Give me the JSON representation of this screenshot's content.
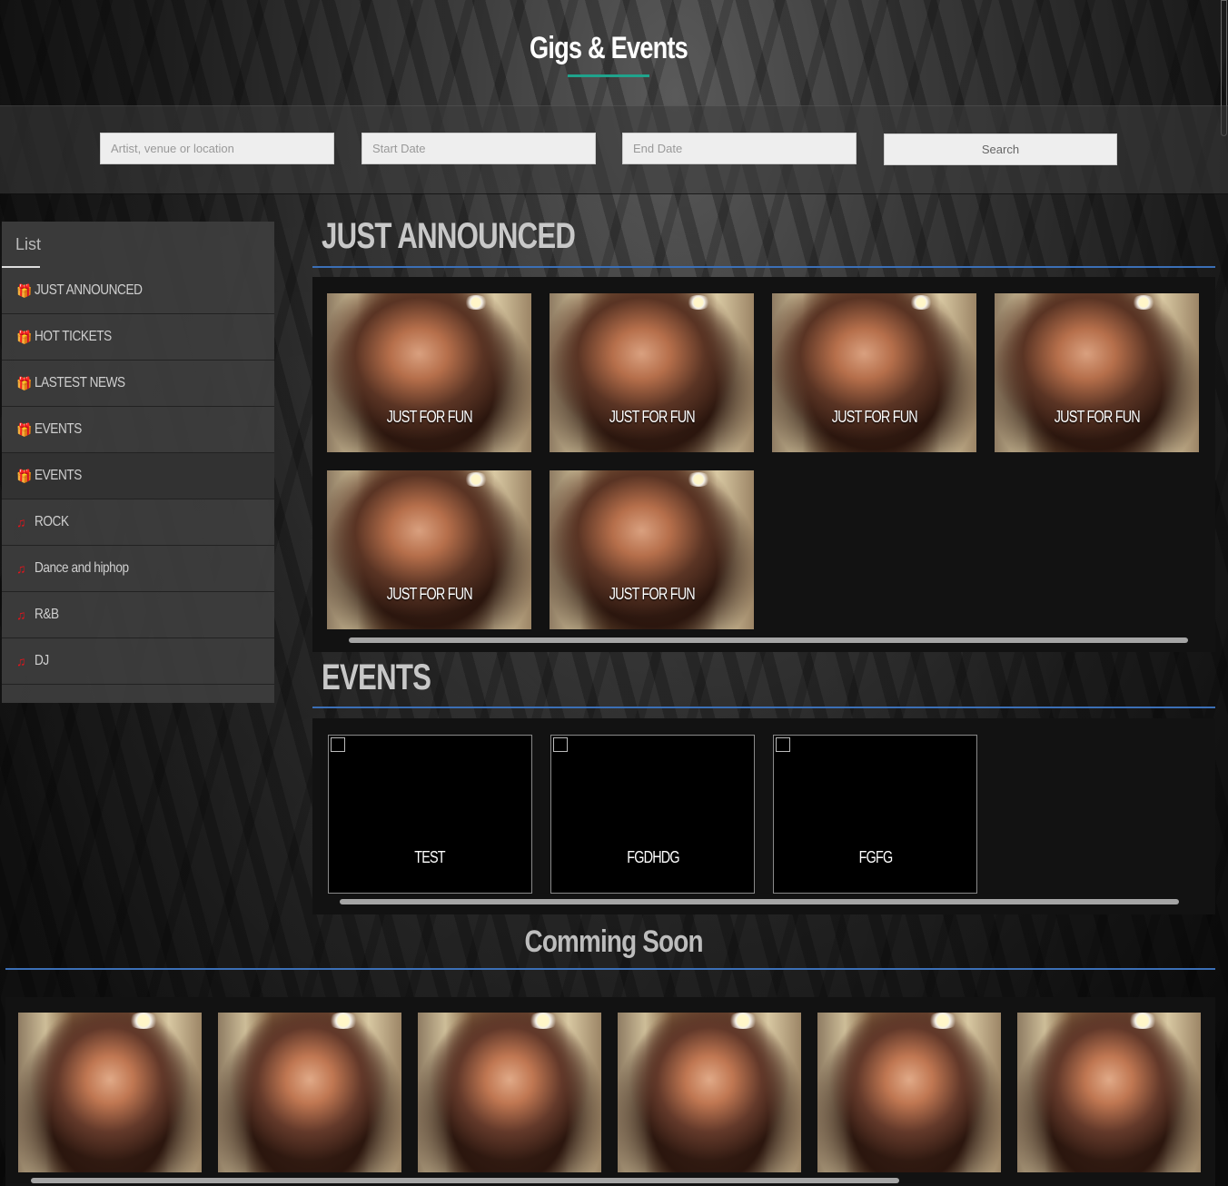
{
  "header": {
    "title": "Gigs & Events"
  },
  "search": {
    "artist_placeholder": "Artist, venue or location",
    "start_placeholder": "Start Date",
    "end_placeholder": "End Date",
    "button_label": "Search"
  },
  "sidebar": {
    "heading": "List",
    "items": [
      {
        "label": "JUST ANNOUNCED",
        "icon": "gift-icon"
      },
      {
        "label": "HOT TICKETS",
        "icon": "gift-icon"
      },
      {
        "label": "LASTEST NEWS",
        "icon": "gift-icon"
      },
      {
        "label": "EVENTS",
        "icon": "gift-icon"
      },
      {
        "label": "EVENTS",
        "icon": "gift-icon"
      },
      {
        "label": "ROCK",
        "icon": "music-note-icon"
      },
      {
        "label": "Dance and hiphop",
        "icon": "music-note-icon"
      },
      {
        "label": "R&B",
        "icon": "music-note-icon"
      },
      {
        "label": "DJ",
        "icon": "music-note-icon"
      }
    ]
  },
  "just_announced": {
    "title": "JUST ANNOUNCED",
    "cards": [
      "JUST FOR FUN",
      "JUST FOR FUN",
      "JUST FOR FUN",
      "JUST FOR FUN",
      "JUST FOR FUN",
      "JUST FOR FUN"
    ]
  },
  "events": {
    "title": "EVENTS",
    "cards": [
      "TEST",
      "FGDHDG",
      "FGFG"
    ]
  },
  "coming_soon": {
    "title": "Comming Soon"
  },
  "colors": {
    "accent_teal": "#1fa38c",
    "section_line_blue": "#3b6fb6",
    "icon_red": "#e3141b"
  }
}
